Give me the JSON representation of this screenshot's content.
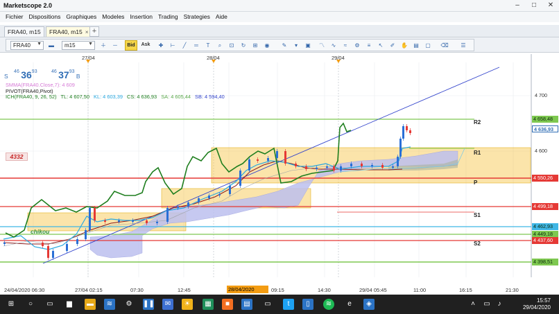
{
  "window": {
    "title": "Marketscope 2.0"
  },
  "menu": [
    "Fichier",
    "Dispositions",
    "Graphiques",
    "Modeles",
    "Insertion",
    "Trading",
    "Strategies",
    "Aide"
  ],
  "tabs": [
    {
      "label": "FRA40, m15"
    },
    {
      "label": "FRA40, m15"
    }
  ],
  "toolbar": {
    "instrument": "FRA40",
    "timeframe": "m15",
    "bid_label": "Bid",
    "ask_label": "Ask"
  },
  "quote": {
    "sell_label": "S",
    "sell_spread": "46",
    "sell_big": "36",
    "sell_frac": "93",
    "buy_spread": "46",
    "buy_big": "37",
    "buy_frac": "93",
    "buy_label": "B"
  },
  "indicators": {
    "smma": "SMMA(FRA40.Close,7): 4 609",
    "pivot": "PIVOT(FRA40,Pivot)",
    "ich_name": "ICH(FRA40, 9, 26, 52)",
    "tl": "TL: 4 607,50",
    "kl": "KL: 4 603,39",
    "cs": "CS: 4 636,93",
    "sa": "SA: 4 605,44",
    "sb": "SB: 4 594,40"
  },
  "badge": "4332",
  "chikou_label": "chikou",
  "levels": {
    "r2": "R2",
    "r1": "R1",
    "p": "P",
    "s1": "S1",
    "s2": "S2"
  },
  "price_axis": {
    "ticks": [
      "4 700",
      "4 600"
    ],
    "labels": [
      {
        "text": "4 658,48",
        "color": "#7ec850"
      },
      {
        "text": "4 636,93",
        "color": "#2f6db5"
      },
      {
        "text": "4 550,26",
        "color": "#e53935"
      },
      {
        "text": "4 499,18",
        "color": "#e53935"
      },
      {
        "text": "4 462,93",
        "color": "#3fb6e5"
      },
      {
        "text": "4 449,18",
        "color": "#7ec850"
      },
      {
        "text": "4 437,60",
        "color": "#e53935"
      },
      {
        "text": "4 398,51",
        "color": "#7ec850"
      }
    ]
  },
  "date_axis_top": [
    "27/04",
    "28/04",
    "29/04"
  ],
  "time_axis": [
    "24/04/2020 06:30",
    "27/04 02:15",
    "07:30",
    "12:45",
    "28/04/2020 05:45",
    "09:15",
    "14:30",
    "29/04 05:45",
    "11:00",
    "16:15",
    "21:30"
  ],
  "taskbar": {
    "time": "15:57",
    "date": "29/04/2020"
  },
  "colors": {
    "resistance": "#e53935",
    "support": "#7ec850",
    "tenkan": "#29a8e0",
    "kijun": "#8b1a1a",
    "chikou": "#1e7e1e",
    "kumo": "#bcc0ef",
    "trendline": "#3344cc",
    "zone": "#f6c343"
  }
}
